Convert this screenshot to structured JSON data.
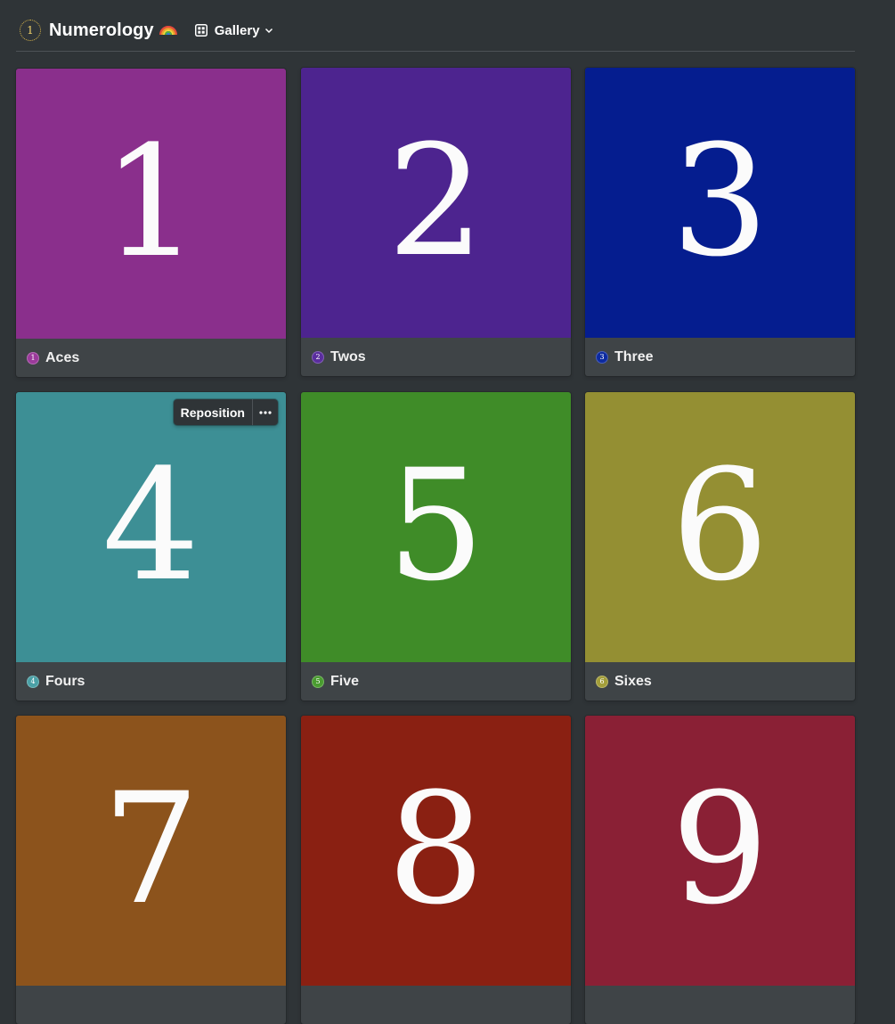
{
  "header": {
    "title": "Numerology",
    "icon_text": "1",
    "view_label": "Gallery",
    "page_icon": "numerology-icon",
    "emoji_icon": "rainbow-icon",
    "view_icon": "gallery-grid-icon",
    "dropdown_icon": "chevron-down-icon"
  },
  "card_tools": {
    "reposition_label": "Reposition",
    "more_icon": "more-horizontal-icon"
  },
  "cards": [
    {
      "numeral": "1",
      "name": "Aces",
      "badge": "1",
      "color": "#8a2f8c",
      "badge_color": "#9b3a9b"
    },
    {
      "numeral": "2",
      "name": "Twos",
      "badge": "2",
      "color": "#4d248f",
      "badge_color": "#5a2d9e"
    },
    {
      "numeral": "3",
      "name": "Three",
      "badge": "3",
      "color": "#051d8f",
      "badge_color": "#0c2aa0"
    },
    {
      "numeral": "4",
      "name": "Fours",
      "badge": "4",
      "color": "#3d8f95",
      "badge_color": "#4aa0a6"
    },
    {
      "numeral": "5",
      "name": "Five",
      "badge": "5",
      "color": "#3f8c28",
      "badge_color": "#4a9c30"
    },
    {
      "numeral": "6",
      "name": "Sixes",
      "badge": "6",
      "color": "#948f33",
      "badge_color": "#a39e3a"
    },
    {
      "numeral": "7",
      "name": "",
      "badge": "",
      "color": "#8c531c",
      "badge_color": "#8c531c"
    },
    {
      "numeral": "8",
      "name": "",
      "badge": "",
      "color": "#8a2012",
      "badge_color": "#8a2012"
    },
    {
      "numeral": "9",
      "name": "",
      "badge": "",
      "color": "#8a2035",
      "badge_color": "#8a2035"
    }
  ]
}
